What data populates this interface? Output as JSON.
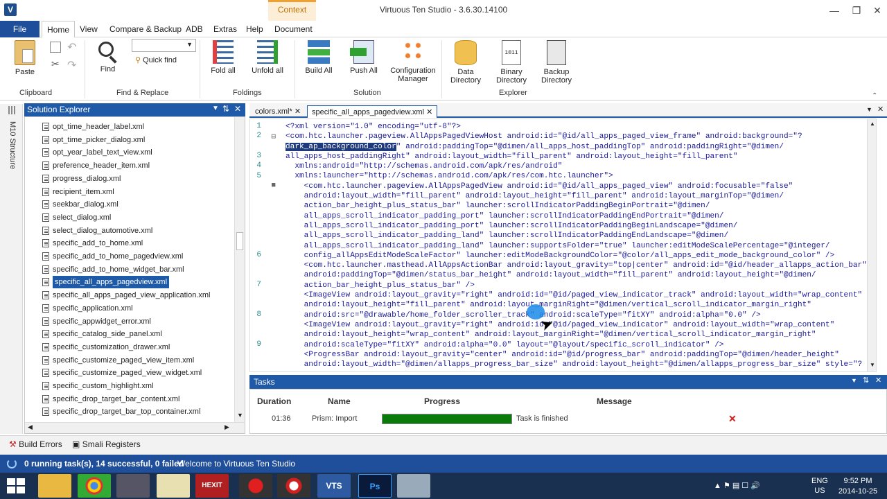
{
  "app": {
    "title": "Virtuous Ten Studio - 3.6.30.14100",
    "context_tab": "Context"
  },
  "menu": {
    "file": "File",
    "tabs": [
      "Home",
      "View",
      "Compare & Backup",
      "ADB",
      "Extras",
      "Help",
      "Document"
    ]
  },
  "ribbon": {
    "paste": "Paste",
    "find": "Find",
    "quick_find": "Quick find",
    "fold_all": "Fold all",
    "unfold_all": "Unfold all",
    "build_all": "Build All",
    "push_all": "Push All",
    "config_manager": "Configuration Manager",
    "data_dir": "Data Directory",
    "binary_dir": "Binary Directory",
    "backup_dir": "Backup Directory",
    "groups": [
      "Clipboard",
      "Find & Replace",
      "Foldings",
      "Solution",
      "Explorer"
    ]
  },
  "sidebar": {
    "structure_label": "M10 Structure"
  },
  "solution_explorer": {
    "title": "Solution Explorer",
    "files": [
      "opt_time_header_label.xml",
      "opt_time_picker_dialog.xml",
      "opt_year_label_text_view.xml",
      "preference_header_item.xml",
      "progress_dialog.xml",
      "recipient_item.xml",
      "seekbar_dialog.xml",
      "select_dialog.xml",
      "select_dialog_automotive.xml",
      "specific_add_to_home.xml",
      "specific_add_to_home_pagedview.xml",
      "specific_add_to_home_widget_bar.xml",
      "specific_all_apps_pagedview.xml",
      "specific_all_apps_paged_view_application.xml",
      "specific_application.xml",
      "specific_appwidget_error.xml",
      "specific_catalog_side_panel.xml",
      "specific_customization_drawer.xml",
      "specific_customize_paged_view_item.xml",
      "specific_customize_paged_view_widget.xml",
      "specific_custom_highlight.xml",
      "specific_drop_target_bar_content.xml",
      "specific_drop_target_bar_top_container.xml"
    ],
    "selected_index": 12
  },
  "editor": {
    "tabs": [
      "colors.xml*",
      "specific_all_apps_pagedview.xml"
    ],
    "line_numbers": [
      "1",
      "2",
      "",
      "3",
      "4",
      "5",
      "",
      "",
      "",
      "",
      "",
      "",
      "",
      "6",
      "",
      "",
      "7",
      "",
      "",
      "8",
      "",
      "",
      "9",
      ""
    ],
    "lines": [
      "<?xml version=\"1.0\" encoding=\"utf-8\"?>",
      "<com.htc.launcher.pageview.AllAppsPagedViewHost android:id=\"@id/all_apps_paged_view_frame\" android:background=\"?",
      "dark_ap_background_color\" android:paddingTop=\"@dimen/all_apps_host_paddingTop\" android:paddingRight=\"@dimen/",
      "all_apps_host_paddingRight\" android:layout_width=\"fill_parent\" android:layout_height=\"fill_parent\"",
      "  xmlns:android=\"http://schemas.android.com/apk/res/android\"",
      "  xmlns:launcher=\"http://schemas.android.com/apk/res/com.htc.launcher\">",
      "    <com.htc.launcher.pageview.AllAppsPagedView android:id=\"@id/all_apps_paged_view\" android:focusable=\"false\"",
      "    android:layout_width=\"fill_parent\" android:layout_height=\"fill_parent\" android:layout_marginTop=\"@dimen/",
      "    action_bar_height_plus_status_bar\" launcher:scrollIndicatorPaddingBeginPortrait=\"@dimen/",
      "    all_apps_scroll_indicator_padding_port\" launcher:scrollIndicatorPaddingEndPortrait=\"@dimen/",
      "    all_apps_scroll_indicator_padding_port\" launcher:scrollIndicatorPaddingBeginLandscape=\"@dimen/",
      "    all_apps_scroll_indicator_padding_land\" launcher:scrollIndicatorPaddingEndLandscape=\"@dimen/",
      "    all_apps_scroll_indicator_padding_land\" launcher:supportsFolder=\"true\" launcher:editModeScalePercentage=\"@integer/",
      "    config_allAppsEditModeScaleFactor\" launcher:editModeBackgroundColor=\"@color/all_apps_edit_mode_background_color\" />",
      "    <com.htc.launcher.masthead.AllAppsActionBar android:layout_gravity=\"top|center\" android:id=\"@id/header_allapps_action_bar\"",
      "    android:paddingTop=\"@dimen/status_bar_height\" android:layout_width=\"fill_parent\" android:layout_height=\"@dimen/",
      "    action_bar_height_plus_status_bar\" />",
      "    <ImageView android:layout_gravity=\"right\" android:id=\"@id/paged_view_indicator_track\" android:layout_width=\"wrap_content\"",
      "    android:layout_height=\"fill_parent\" android:layout_marginRight=\"@dimen/vertical_scroll_indicator_margin_right\"",
      "    android:src=\"@drawable/home_folder_scroller_track\" android:scaleType=\"fitXY\" android:alpha=\"0.0\" />",
      "    <ImageView android:layout_gravity=\"right\" android:id=\"@id/paged_view_indicator\" android:layout_width=\"wrap_content\"",
      "    android:layout_height=\"wrap_content\" android:layout_marginRight=\"@dimen/vertical_scroll_indicator_margin_right\"",
      "    android:scaleType=\"fitXY\" android:alpha=\"0.0\" layout=\"@layout/specific_scroll_indicator\" />",
      "    <ProgressBar android:layout_gravity=\"center\" android:id=\"@id/progress_bar\" android:paddingTop=\"@dimen/header_height\"",
      "    android:layout_width=\"@dimen/allapps_progress_bar_size\" android:layout_height=\"@dimen/allapps_progress_bar_size\" style=\"?"
    ]
  },
  "tasks": {
    "title": "Tasks",
    "headers": [
      "Duration",
      "Name",
      "Progress",
      "Message"
    ],
    "row": {
      "duration": "01:36",
      "name": "Prism: Import",
      "progress": 1.0,
      "message": "Task is finished"
    }
  },
  "bottom_tabs": [
    "Build Errors",
    "Smali Registers"
  ],
  "status": {
    "running": "0 running task(s), 14 successful, 0 failed",
    "welcome": "Welcome to Virtuous Ten Studio"
  },
  "tray": {
    "lang": "ENG",
    "region": "US",
    "time": "9:52 PM",
    "date": "2014-10-25"
  },
  "colors": {
    "accent": "#1f5aa8",
    "progress": "#0a7a0a"
  }
}
